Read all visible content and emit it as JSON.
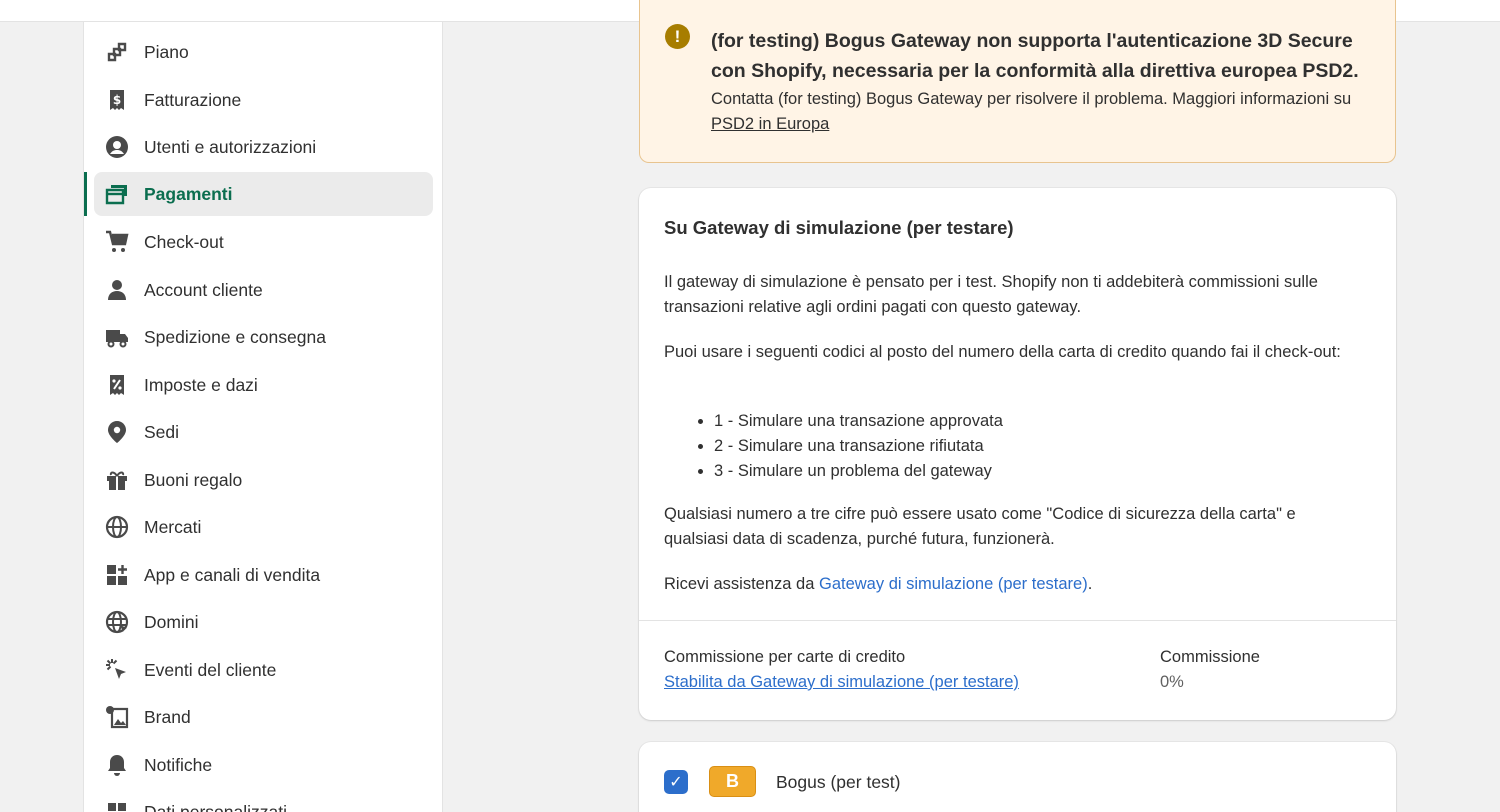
{
  "sidebar": {
    "items": [
      {
        "label": "Piano",
        "icon": "plan-icon",
        "active": false
      },
      {
        "label": "Fatturazione",
        "icon": "billing-icon",
        "active": false
      },
      {
        "label": "Utenti e autorizzazioni",
        "icon": "user-circle-icon",
        "active": false
      },
      {
        "label": "Pagamenti",
        "icon": "payments-icon",
        "active": true
      },
      {
        "label": "Check-out",
        "icon": "cart-icon",
        "active": false
      },
      {
        "label": "Account cliente",
        "icon": "person-icon",
        "active": false
      },
      {
        "label": "Spedizione e consegna",
        "icon": "truck-icon",
        "active": false
      },
      {
        "label": "Imposte e dazi",
        "icon": "tax-icon",
        "active": false
      },
      {
        "label": "Sedi",
        "icon": "location-pin-icon",
        "active": false
      },
      {
        "label": "Buoni regalo",
        "icon": "gift-icon",
        "active": false
      },
      {
        "label": "Mercati",
        "icon": "globe-markets-icon",
        "active": false
      },
      {
        "label": "App e canali di vendita",
        "icon": "apps-icon",
        "active": false
      },
      {
        "label": "Domini",
        "icon": "domain-globe-icon",
        "active": false
      },
      {
        "label": "Eventi del cliente",
        "icon": "cursor-click-icon",
        "active": false
      },
      {
        "label": "Brand",
        "icon": "brand-image-icon",
        "active": false
      },
      {
        "label": "Notifiche",
        "icon": "bell-icon",
        "active": false
      },
      {
        "label": "Dati personalizzati",
        "icon": "custom-data-icon",
        "active": false
      }
    ]
  },
  "banner": {
    "title": "(for testing) Bogus Gateway non supporta l'autenticazione 3D Secure con Shopify, necessaria per la conformità alla direttiva europea PSD2.",
    "body_prefix": "Contatta (for testing) Bogus Gateway per risolvere il problema. Maggiori informazioni su ",
    "body_link": "PSD2 in Europa"
  },
  "gateway_card": {
    "title": "Su Gateway di simulazione (per testare)",
    "para1": "Il gateway di simulazione è pensato per i test. Shopify non ti addebiterà commissioni sulle transazioni relative agli ordini pagati con questo gateway.",
    "para2": "Puoi usare i seguenti codici al posto del numero della carta di credito quando fai il check-out:",
    "codes": [
      "1 - Simulare una transazione approvata",
      "2 - Simulare una transazione rifiutata",
      "3 - Simulare un problema del gateway"
    ],
    "para3": "Qualsiasi numero a tre cifre può essere usato come \"Codice di sicurezza della carta\" e qualsiasi data di scadenza, purché futura, funzionerà.",
    "support_prefix": "Ricevi assistenza da ",
    "support_link": "Gateway di simulazione (per testare)",
    "support_suffix": ".",
    "fee_label": "Commissione per carte di credito",
    "fee_link": "Stabilita da Gateway di simulazione (per testare)",
    "commission_label": "Commissione",
    "commission_value": "0%"
  },
  "provider_card": {
    "checked": true,
    "logo_letter": "B",
    "name": "Bogus (per test)"
  },
  "colors": {
    "accent": "#0b6e4f",
    "link": "#2c6ecb",
    "warning_bg": "#fff4e6",
    "warning_icon": "#a77d00",
    "bogus_logo": "#f0a92a"
  }
}
